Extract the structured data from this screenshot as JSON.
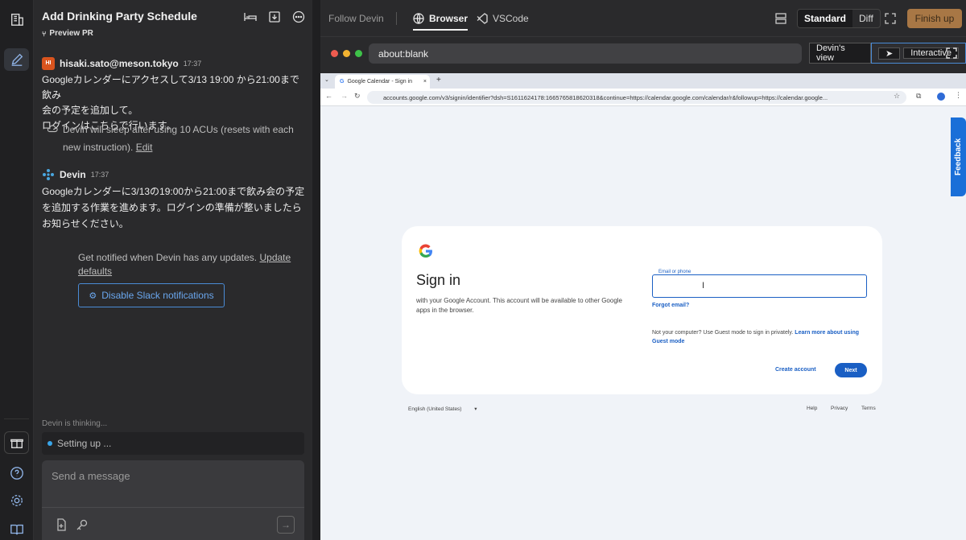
{
  "chat": {
    "title": "Add Drinking Party Schedule",
    "preview_pr": "Preview PR",
    "user_message": {
      "avatar": "HI",
      "author": "hisaki.sato@meson.tokyo",
      "time": "17:37",
      "line1": "Googleカレンダーにアクセスして3/13 19:00 から21:00まで飲み",
      "line2": "会の予定を追加して。",
      "line3": "ログインはこちらで行います。"
    },
    "sleep_notice": {
      "text": "Devin will sleep after using 10 ACUs (resets with each new instruction).",
      "edit_link": "Edit"
    },
    "devin_message": {
      "author": "Devin",
      "time": "17:37",
      "text": "Googleカレンダーに3/13の19:00から21:00まで飲み会の予定を追加する作業を進めます。ログインの準備が整いましたらお知らせください。"
    },
    "notify_text": "Get notified when Devin has any updates.",
    "notify_link": "Update defaults",
    "slack_button": "Disable Slack notifications",
    "thinking": "Devin is thinking...",
    "status": "Setting up ...",
    "composer_placeholder": "Send a message"
  },
  "topbar": {
    "follow": "Follow Devin",
    "tab_browser": "Browser",
    "tab_vscode": "VSCode",
    "mode_standard": "Standard",
    "mode_diff": "Diff",
    "finish": "Finish up"
  },
  "browser": {
    "url": "about:blank",
    "view_devin": "Devin's view",
    "view_interactive": "Interactive"
  },
  "remote": {
    "tab_title": "Google Calendar - Sign in",
    "address": "accounts.google.com/v3/signin/identifier?dsh=S1611624178:1665765818620318&continue=https://calendar.google.com/calendar/r&followup=https://calendar.google...",
    "heading": "Sign in",
    "subtext": "with your Google Account. This account will be available to other Google apps in the browser.",
    "field_label": "Email or phone",
    "forgot": "Forgot email?",
    "guest_text": "Not your computer? Use Guest mode to sign in privately.",
    "guest_link": "Learn more about using Guest mode",
    "create_account": "Create account",
    "next": "Next",
    "language": "English (United States)",
    "help": "Help",
    "privacy": "Privacy",
    "terms": "Terms",
    "feedback": "Feedback"
  },
  "colors": {
    "accent_blue": "#1a5fc4",
    "finish_button": "#a87745",
    "link_blue": "#4a8bd6"
  }
}
